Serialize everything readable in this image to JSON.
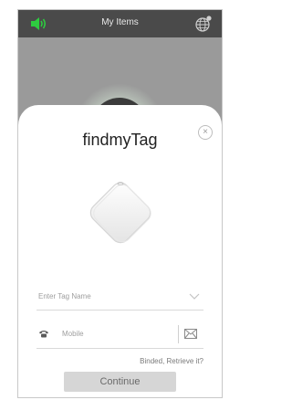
{
  "header": {
    "title": "My Items",
    "sound_icon": "speaker-volume-icon",
    "globe_icon": "globe-settings-icon"
  },
  "modal": {
    "brand": "findmyTag",
    "close_icon": "close-icon",
    "close_glyph": "×",
    "tag_name": {
      "placeholder": "Enter Tag Name",
      "dropdown_icon": "chevron-down-icon"
    },
    "mobile": {
      "placeholder": "Mobile",
      "phone_icon": "phone-icon",
      "mail_icon": "mail-icon"
    },
    "retrieve_link": "Binded, Retrieve it?",
    "continue_label": "Continue"
  },
  "colors": {
    "sound_green": "#2ecc40",
    "topbar": "#4a4a4a",
    "button_bg": "#d6d6d6"
  }
}
